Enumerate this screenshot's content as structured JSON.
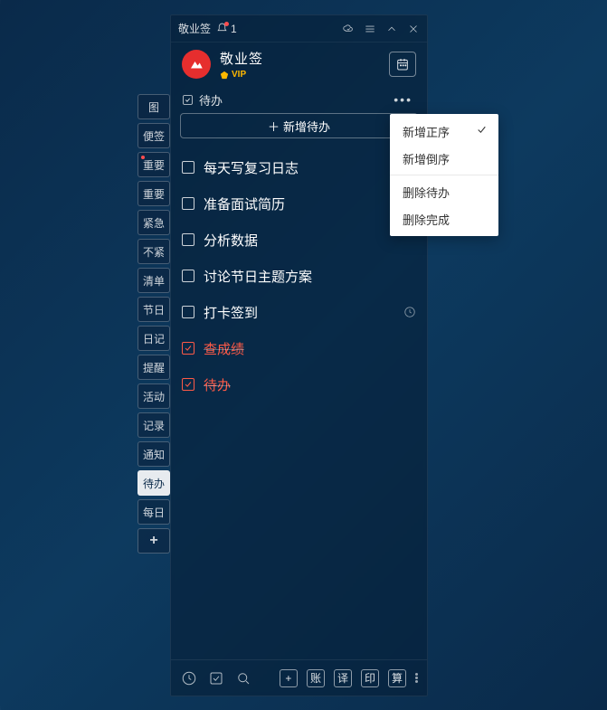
{
  "titlebar": {
    "app_name": "敬业签",
    "notif_count": "1"
  },
  "header": {
    "brand": "敬业签",
    "vip_label": "VIP"
  },
  "section": {
    "title": "待办",
    "add_button": "新增待办"
  },
  "sidebar_tabs": [
    {
      "label": "图",
      "active": false,
      "dot": false
    },
    {
      "label": "便签",
      "active": false,
      "dot": false
    },
    {
      "label": "重要",
      "active": false,
      "dot": true
    },
    {
      "label": "重要",
      "active": false,
      "dot": false
    },
    {
      "label": "紧急",
      "active": false,
      "dot": false
    },
    {
      "label": "不紧",
      "active": false,
      "dot": false
    },
    {
      "label": "清单",
      "active": false,
      "dot": false
    },
    {
      "label": "节日",
      "active": false,
      "dot": false
    },
    {
      "label": "日记",
      "active": false,
      "dot": false
    },
    {
      "label": "提醒",
      "active": false,
      "dot": false
    },
    {
      "label": "活动",
      "active": false,
      "dot": false
    },
    {
      "label": "记录",
      "active": false,
      "dot": false
    },
    {
      "label": "通知",
      "active": false,
      "dot": false
    },
    {
      "label": "待办",
      "active": true,
      "dot": false
    },
    {
      "label": "每日",
      "active": false,
      "dot": false
    }
  ],
  "todos": [
    {
      "text": "每天写复习日志",
      "done": false,
      "has_clock": false
    },
    {
      "text": "准备面试简历",
      "done": false,
      "has_clock": false
    },
    {
      "text": "分析数据",
      "done": false,
      "has_clock": false
    },
    {
      "text": "讨论节日主题方案",
      "done": false,
      "has_clock": false
    },
    {
      "text": "打卡签到",
      "done": false,
      "has_clock": true
    },
    {
      "text": "查成绩",
      "done": true,
      "has_clock": false
    },
    {
      "text": "待办",
      "done": true,
      "has_clock": false
    }
  ],
  "dropdown": {
    "items": [
      {
        "label": "新增正序",
        "checked": true
      },
      {
        "label": "新增倒序",
        "checked": false
      }
    ],
    "items2": [
      {
        "label": "删除待办",
        "checked": false
      },
      {
        "label": "删除完成",
        "checked": false
      }
    ]
  },
  "bottom": {
    "plus": "+",
    "b1": "账",
    "b2": "译",
    "b3": "印",
    "b4": "算"
  }
}
